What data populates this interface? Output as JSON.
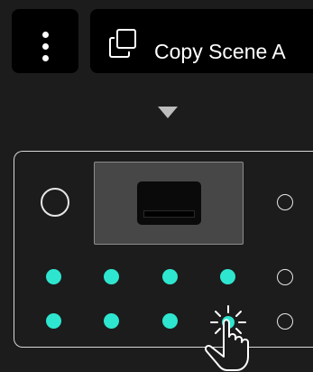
{
  "toolbar": {
    "menu_icon": "more-vertical-icon",
    "copy_icon": "copy-icon",
    "copy_label": "Copy Scene A"
  },
  "indicator_icon": "triangle-down-icon",
  "device": {
    "knob_icon": "circle-outline",
    "pad_color": "#2ee6cf",
    "pads": [
      {
        "row": 1,
        "col": 1,
        "state": "on"
      },
      {
        "row": 1,
        "col": 2,
        "state": "on"
      },
      {
        "row": 1,
        "col": 3,
        "state": "on"
      },
      {
        "row": 1,
        "col": 4,
        "state": "on"
      },
      {
        "row": 2,
        "col": 1,
        "state": "on"
      },
      {
        "row": 2,
        "col": 2,
        "state": "on"
      },
      {
        "row": 2,
        "col": 3,
        "state": "on"
      },
      {
        "row": 2,
        "col": 4,
        "state": "tapped"
      }
    ],
    "side_buttons": 3,
    "gesture_icon": "tap-hand-icon"
  }
}
